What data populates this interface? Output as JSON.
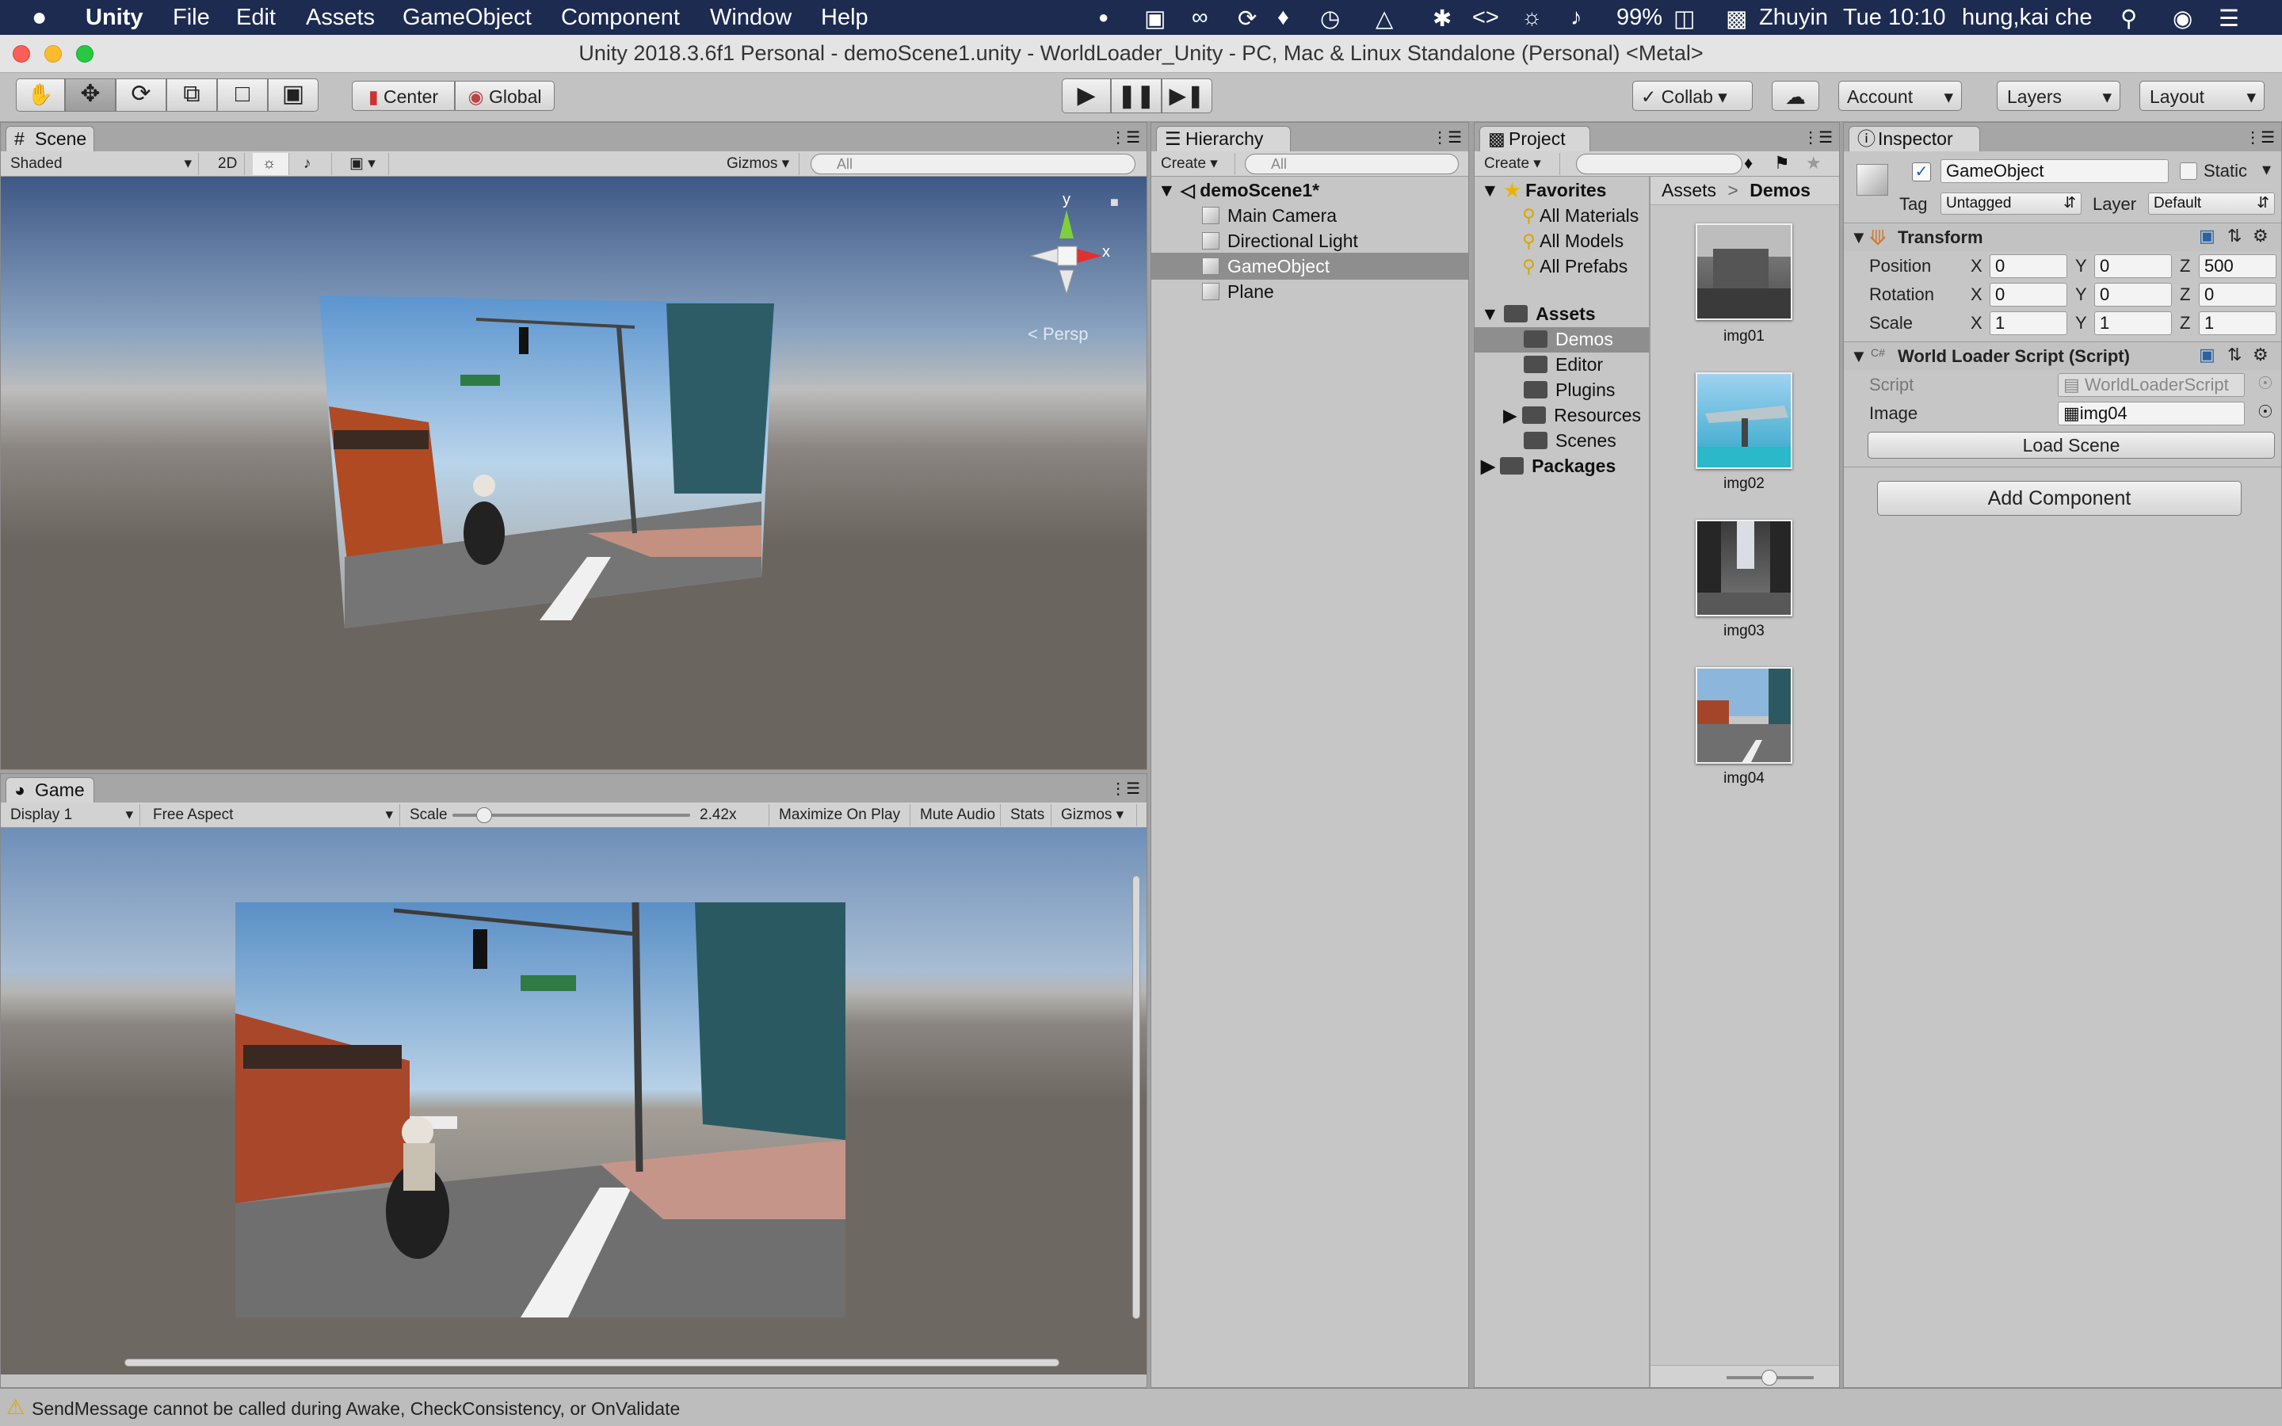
{
  "menubar": {
    "apple": "",
    "app": "Unity",
    "items": [
      "File",
      "Edit",
      "Assets",
      "GameObject",
      "Component",
      "Window",
      "Help"
    ],
    "battery": "99%",
    "input_method": "Zhuyin",
    "clock": "Tue 10:10",
    "user": "hung,kai che"
  },
  "window": {
    "title": "Unity 2018.3.6f1 Personal - demoScene1.unity - WorldLoader_Unity - PC, Mac & Linux Standalone (Personal) <Metal>"
  },
  "toolbar": {
    "pivot": "Center",
    "space": "Global",
    "collab": "Collab",
    "account": "Account",
    "layers": "Layers",
    "layout": "Layout"
  },
  "scene": {
    "tab": "Scene",
    "shading": "Shaded",
    "mode_2d": "2D",
    "gizmos": "Gizmos",
    "search_placeholder": "All",
    "axis_y": "y",
    "axis_x": "x",
    "persp": "< Persp"
  },
  "game": {
    "tab": "Game",
    "display": "Display 1",
    "aspect": "Free Aspect",
    "scale_label": "Scale",
    "scale_value": "2.42x",
    "maximize": "Maximize On Play",
    "mute": "Mute Audio",
    "stats": "Stats",
    "gizmos": "Gizmos"
  },
  "hierarchy": {
    "tab": "Hierarchy",
    "create": "Create",
    "search_placeholder": "All",
    "scene_name": "demoScene1*",
    "items": [
      "Main Camera",
      "Directional Light",
      "GameObject",
      "Plane"
    ]
  },
  "project": {
    "tab": "Project",
    "create": "Create",
    "favorites": "Favorites",
    "fav_items": [
      "All Materials",
      "All Models",
      "All Prefabs"
    ],
    "assets": "Assets",
    "asset_folders": [
      "Demos",
      "Editor",
      "Plugins",
      "Resources",
      "Scenes"
    ],
    "packages": "Packages",
    "breadcrumb_root": "Assets",
    "breadcrumb_sep": ">",
    "breadcrumb_current": "Demos",
    "thumbnails": [
      "img01",
      "img02",
      "img03",
      "img04"
    ]
  },
  "inspector": {
    "tab": "Inspector",
    "object_name": "GameObject",
    "static": "Static",
    "tag_label": "Tag",
    "tag_value": "Untagged",
    "layer_label": "Layer",
    "layer_value": "Default",
    "transform": "Transform",
    "rows": [
      {
        "label": "Position",
        "x": "0",
        "y": "0",
        "z": "500"
      },
      {
        "label": "Rotation",
        "x": "0",
        "y": "0",
        "z": "0"
      },
      {
        "label": "Scale",
        "x": "1",
        "y": "1",
        "z": "1"
      }
    ],
    "axis_x": "X",
    "axis_y": "Y",
    "axis_z": "Z",
    "script_component": "World Loader Script (Script)",
    "script_label": "Script",
    "script_value": "WorldLoaderScript",
    "image_label": "Image",
    "image_value": "img04",
    "load_scene": "Load Scene",
    "add_component": "Add Component"
  },
  "console": {
    "message": "SendMessage cannot be called during Awake, CheckConsistency, or OnValidate"
  },
  "colors": {
    "menubar": "#1d2b51",
    "panel": "#c2c2c2",
    "selection": "#8e8e8e",
    "scene_ground": "#6b6560"
  }
}
